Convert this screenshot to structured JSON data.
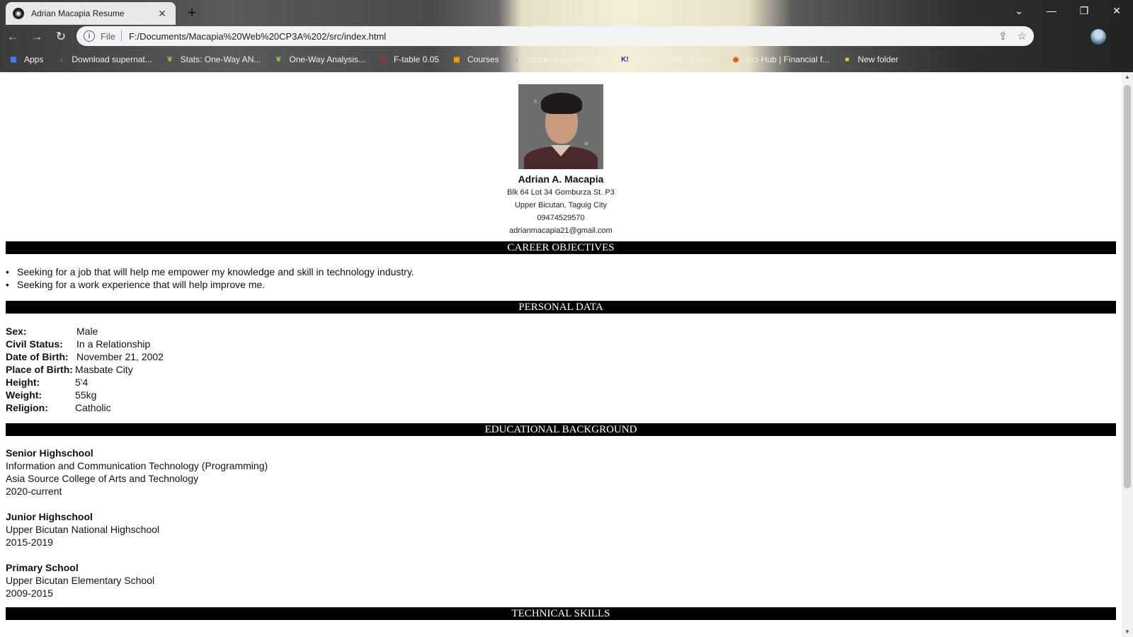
{
  "browser": {
    "tab_title": "Adrian Macapia Resume",
    "tab_close": "✕",
    "new_tab": "+",
    "scheme": "File",
    "url": "F:/Documents/Macapia%20Web%20CP3A%202/src/index.html",
    "bookmarks": [
      {
        "label": "Apps",
        "icon": "apps-grid-icon",
        "color": "#4285f4"
      },
      {
        "label": "Download supernat...",
        "icon": "download-icon",
        "color": "#d4a017"
      },
      {
        "label": "Stats: One-Way AN...",
        "icon": "leaf-icon",
        "color": "#8bc34a"
      },
      {
        "label": "One-Way Analysis...",
        "icon": "leaf-icon",
        "color": "#8bc34a"
      },
      {
        "label": "F-table 0.05",
        "icon": "shield-icon",
        "color": "#c62828"
      },
      {
        "label": "Courses",
        "icon": "classroom-icon",
        "color": "#f9ab00"
      },
      {
        "label": "cracked-games.org...",
        "icon": "download-icon",
        "color": "#1e88e5"
      },
      {
        "label": "Play Kahoot! - Enter...",
        "icon": "kahoot-icon",
        "color": "#46178f"
      },
      {
        "label": "Sci-Hub | Financial f...",
        "icon": "eye-icon",
        "color": "#e65100"
      },
      {
        "label": "New folder",
        "icon": "folder-icon",
        "color": "#f4c430"
      }
    ]
  },
  "resume": {
    "name": "Adrian A. Macapia",
    "address_line1": "Blk 64 Lot 34 Gomburza St. P3",
    "address_line2": "Upper Bicutan, Taguig City",
    "phone": "09474529570",
    "email": "adrianmacapia21@gmail.com",
    "sections": {
      "career": "CAREER OBJECTIVES",
      "personal": "PERSONAL DATA",
      "education": "EDUCATIONAL BACKGROUND",
      "skills": "TECHNICAL SKILLS"
    },
    "objectives": [
      "Seeking for a job that will help me empower my knowledge and skill in technology industry.",
      "Seeking for a work experience that will help improve me."
    ],
    "personal": [
      {
        "label": "Sex:",
        "value": "Male"
      },
      {
        "label": "Civil Status:",
        "value": "In a Relationship"
      },
      {
        "label": "Date of Birth:",
        "value": "November 21, 2002"
      },
      {
        "label": "Place of Birth:",
        "value": "Masbate City"
      },
      {
        "label": "Height:",
        "value": "5'4"
      },
      {
        "label": "Weight:",
        "value": "55kg"
      },
      {
        "label": "Religion:",
        "value": "Catholic"
      }
    ],
    "education": [
      {
        "level": "Senior Highschool",
        "lines": [
          "Information and Communication Technology (Programming)",
          "Asia Source College of Arts and Technology",
          "2020-current"
        ]
      },
      {
        "level": "Junior Highschool",
        "lines": [
          "Upper Bicutan National Highschool",
          "2015-2019"
        ]
      },
      {
        "level": "Primary School",
        "lines": [
          "Upper Bicutan Elementary School",
          "2009-2015"
        ]
      }
    ]
  }
}
